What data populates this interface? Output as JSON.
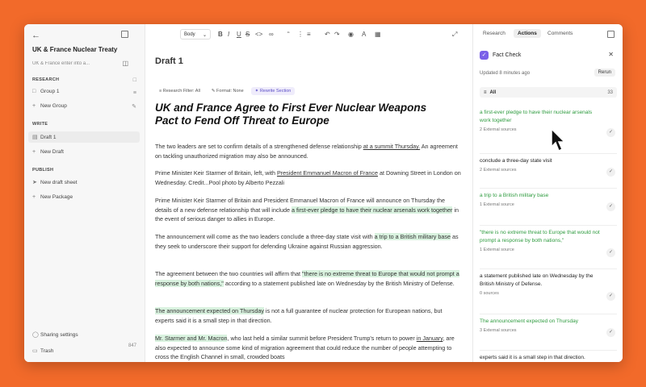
{
  "sidebar": {
    "doc_title": "UK & France Nuclear Treaty",
    "doc_subtitle": "UK & France enter into a...",
    "research_label": "RESEARCH",
    "research_items": [
      {
        "label": "Group 1"
      },
      {
        "label": "New Group"
      }
    ],
    "write_label": "WRITE",
    "write_items": [
      {
        "label": "Draft 1"
      },
      {
        "label": "New Draft"
      }
    ],
    "publish_label": "PUBLISH",
    "publish_items": [
      {
        "label": "New draft sheet"
      },
      {
        "label": "New Package"
      }
    ],
    "sharing": "Sharing settings",
    "trash": "Trash",
    "word_count": "847"
  },
  "editor": {
    "style_select": "Body",
    "draft_title": "Draft 1",
    "chips": {
      "research_filter": "Research Filter: All",
      "format": "Format: None",
      "rewrite": "Rewrite Section"
    },
    "headline": "UK and France Agree to First Ever Nuclear Weapons Pact to Fend Off Threat to Europe",
    "p1a": "The two leaders are set to confirm details of a strengthened defense relationship ",
    "p1b": "at a summit Thursday.",
    "p1c": " An agreement on tackling unauthorized migration may also be announced.",
    "p2a": "Prime Minister Keir Starmer of Britain, left, with ",
    "p2b": "President Emmanuel Macron of France",
    "p2c": " at Downing Street in London on Wednesday. Credit...Pool photo by Alberto Pezzali",
    "p3a": "Prime Minister Keir Starmer of Britain and President Emmanuel Macron of France will announce on Thursday the details of a new defense relationship that will include ",
    "p3b": "a first-ever pledge to have their nuclear arsenals work together",
    "p3c": " in the event of serious danger to allies in Europe.",
    "p4a": "The announcement will come as the two leaders conclude a three-day state visit with ",
    "p4b": "a trip to a British military base",
    "p4c": " as they seek to underscore their support for defending Ukraine against Russian aggression.",
    "p5a": "The agreement between the two countries will affirm that ",
    "p5b": "\"there is no extreme threat to Europe that would not prompt a response by both nations,\"",
    "p5c": " according to a statement published late on Wednesday by the British Ministry of Defense.",
    "p6a": "The announcement expected on Thursday",
    "p6b": " is not a full guarantee of nuclear protection for European nations, but experts said it is a small step in that direction.",
    "p7a": "Mr. Starmer and Mr. Macron",
    "p7b": ", who last held a similar summit before President Trump's return to power ",
    "p7c": "in January",
    "p7d": ", are also expected to announce some kind of migration agreement that could reduce the number of people attempting to cross the English Channel in small, crowded boats"
  },
  "panel": {
    "tabs": [
      "Research",
      "Actions",
      "Comments"
    ],
    "fact_check_title": "Fact Check",
    "updated": "Updated 8 minutes ago",
    "rerun": "Rerun",
    "all_label": "All",
    "all_count": "33",
    "cards": [
      {
        "title": "a first-ever pledge to have their nuclear arsenals work together",
        "sources": "2 External sources"
      },
      {
        "title": "conclude a three-day state visit",
        "sources": "2 External sources"
      },
      {
        "title": "a trip to a British military base",
        "sources": "1 External source"
      },
      {
        "title": "\"there is no extreme threat to Europe that would not prompt a response by both nations,\"",
        "sources": "1 External source"
      },
      {
        "title": "a statement published late on Wednesday by the British Ministry of Defense.",
        "sources": "0 sources"
      },
      {
        "title": "The announcement expected on Thursday",
        "sources": "3 External sources"
      },
      {
        "title": "experts said it is a small step in that direction.",
        "sources": ""
      }
    ]
  },
  "colors": {
    "accent": "#7b61e8",
    "highlight": "#d9f2df",
    "green_text": "#2e9b3f",
    "background": "#f26a2a"
  }
}
